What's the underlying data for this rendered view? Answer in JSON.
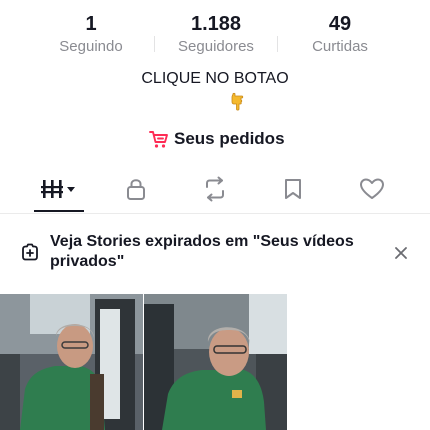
{
  "stats": {
    "following": {
      "value": "1",
      "label": "Seguindo"
    },
    "followers": {
      "value": "1.188",
      "label": "Seguidores"
    },
    "likes": {
      "value": "49",
      "label": "Curtidas"
    }
  },
  "bio": {
    "text": "CLIQUE NO BOTAO",
    "emoji_icon": "pointing-down-hand-emoji"
  },
  "orders": {
    "label": "Seus pedidos",
    "icon": "cart-icon",
    "icon_color": "#fe2c55"
  },
  "tabs": [
    {
      "id": "videos",
      "icon": "grid-columns-icon",
      "selected": true
    },
    {
      "id": "private",
      "icon": "lock-icon"
    },
    {
      "id": "reposts",
      "icon": "repost-icon"
    },
    {
      "id": "favorites",
      "icon": "bookmark-icon"
    },
    {
      "id": "liked",
      "icon": "heart-icon"
    }
  ],
  "banner": {
    "text": "Veja Stories expirados em \"Seus vídeos privados\"",
    "icon": "story-plus-icon",
    "close_icon": "close-icon"
  },
  "grid": {
    "items": [
      {
        "type": "video-thumbnail"
      },
      {
        "type": "video-thumbnail"
      }
    ]
  },
  "colors": {
    "text": "#161823",
    "muted": "#8a8b91",
    "accent": "#fe2c55"
  }
}
